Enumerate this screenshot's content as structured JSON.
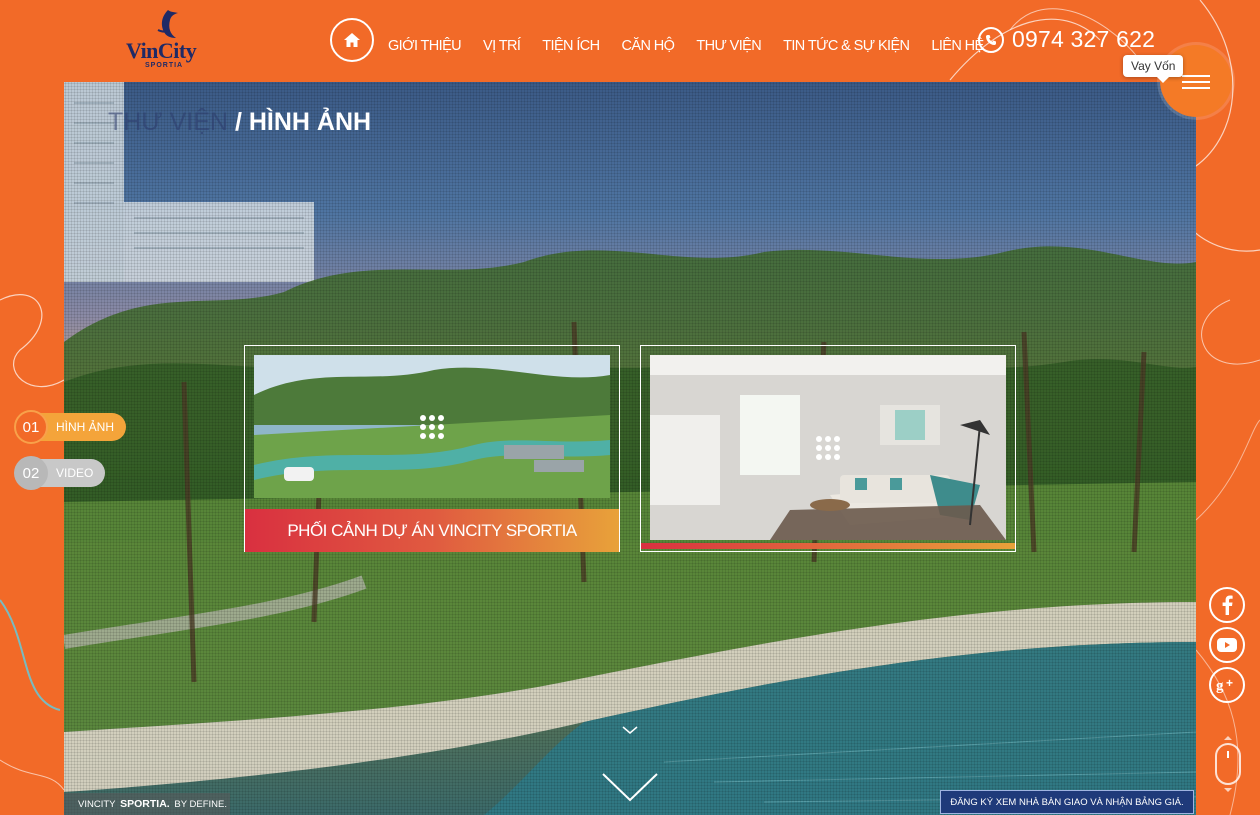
{
  "brand": {
    "name": "VinCity",
    "sub": "SPORTIA"
  },
  "nav": {
    "items": [
      "GIỚI THIỆU",
      "VỊ TRÍ",
      "TIỆN ÍCH",
      "CĂN HỘ",
      "THƯ VIỆN",
      "TIN TỨC & SỰ KIỆN",
      "LIÊN HỆ"
    ]
  },
  "contact": {
    "phone": "0974 327 622"
  },
  "menu": {
    "tooltip": "Vay Vốn"
  },
  "breadcrumb": {
    "parent": "THƯ VIỆN",
    "separator": "/",
    "current": "HÌNH ẢNH"
  },
  "cards": [
    {
      "label": "PHỐI CẢNH DỰ ÁN VINCITY SPORTIA"
    },
    {
      "label": ""
    }
  ],
  "side_tabs": [
    {
      "num": "01",
      "label": "HÌNH ẢNH"
    },
    {
      "num": "02",
      "label": "VIDEO"
    }
  ],
  "footer": {
    "credit_pre": "VINCITY",
    "credit_bold": "SPORTIA.",
    "credit_post": "BY DEFINE.",
    "register": "ĐĂNG KÝ XEM NHÀ BÀN GIAO VÀ NHẬN BẢNG GIÁ."
  },
  "colors": {
    "brand_orange": "#f26a28",
    "brand_navy": "#1f2a66",
    "accent_gold": "#f4a43a"
  }
}
